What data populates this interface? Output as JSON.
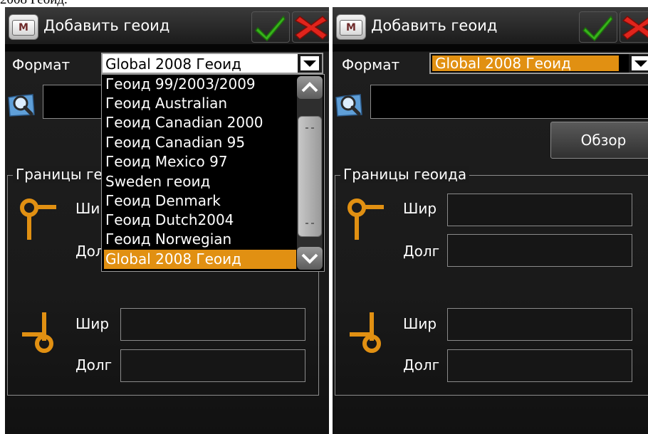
{
  "caption": "2008 Геоид.",
  "dialog": {
    "title": "Добавить геоид",
    "menu_icon_letter": "M",
    "format_label": "Формат",
    "format_value": "Global 2008 Геоид",
    "browse_label": "Обзор",
    "group_label": "Границы геоида",
    "group_label_truncated": "Границы ге",
    "lat_label": "Шир",
    "lon_label": "Долг",
    "lat_label_partial": "Ши",
    "lon_label_partial": "Дол"
  },
  "dropdown": {
    "items": [
      "Геоид 99/2003/2009",
      "Геоид Australian",
      "Геоид Canadian 2000",
      "Геоид Canadian 95",
      "Геоид Mexico 97",
      "Sweden геоид",
      "Геоид Denmark",
      "Геоид Dutch2004",
      "Геоид Norwegian",
      "Global 2008 Геоид"
    ],
    "selected_index": 9
  },
  "colors": {
    "accent": "#e19012",
    "ok": "#37b31b",
    "cancel": "#e0241c"
  }
}
